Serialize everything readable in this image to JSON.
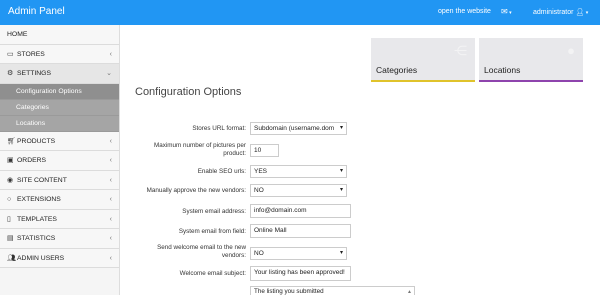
{
  "topbar": {
    "brand": "Admin Panel",
    "open_site": "open the website",
    "mail_icon": "envelope-icon",
    "user": "administrator"
  },
  "sidebar": {
    "home": "HOME",
    "items": [
      {
        "label": "STORES",
        "icon": "laptop-icon"
      },
      {
        "label": "SETTINGS",
        "icon": "gears-icon"
      },
      {
        "label": "PRODUCTS",
        "icon": "cart-icon"
      },
      {
        "label": "ORDERS",
        "icon": "money-icon"
      },
      {
        "label": "SITE CONTENT",
        "icon": "globe-icon"
      },
      {
        "label": "EXTENSIONS",
        "icon": "circle-icon"
      },
      {
        "label": "TEMPLATES",
        "icon": "file-icon"
      },
      {
        "label": "STATISTICS",
        "icon": "chart-icon"
      },
      {
        "label": "ADMIN USERS",
        "icon": "users-icon"
      }
    ],
    "settings_sub": [
      "Configuration Options",
      "Categories",
      "Locations"
    ]
  },
  "cards": {
    "categories": "Categories",
    "locations": "Locations",
    "categories_color": "#e0c32b",
    "locations_color": "#8e44ad"
  },
  "page_title": "Configuration Options",
  "form": {
    "stores_url_label": "Stores URL format:",
    "stores_url_value": "Subdomain (username.dom",
    "max_pictures_label": "Maximum number of pictures per product:",
    "max_pictures_value": "10",
    "seo_label": "Enable SEO urls:",
    "seo_value": "YES",
    "approve_label": "Manually approve the new vendors:",
    "approve_value": "NO",
    "email_label": "System email address:",
    "email_value": "info@domain.com",
    "from_label": "System email from field:",
    "from_value": "Online Mall",
    "welcome_label": "Send welcome email to the new vendors:",
    "welcome_value": "NO",
    "subject_label": "Welcome email subject:",
    "subject_value": "Your listing has been approved!",
    "body_value": "The listing you submitted"
  }
}
